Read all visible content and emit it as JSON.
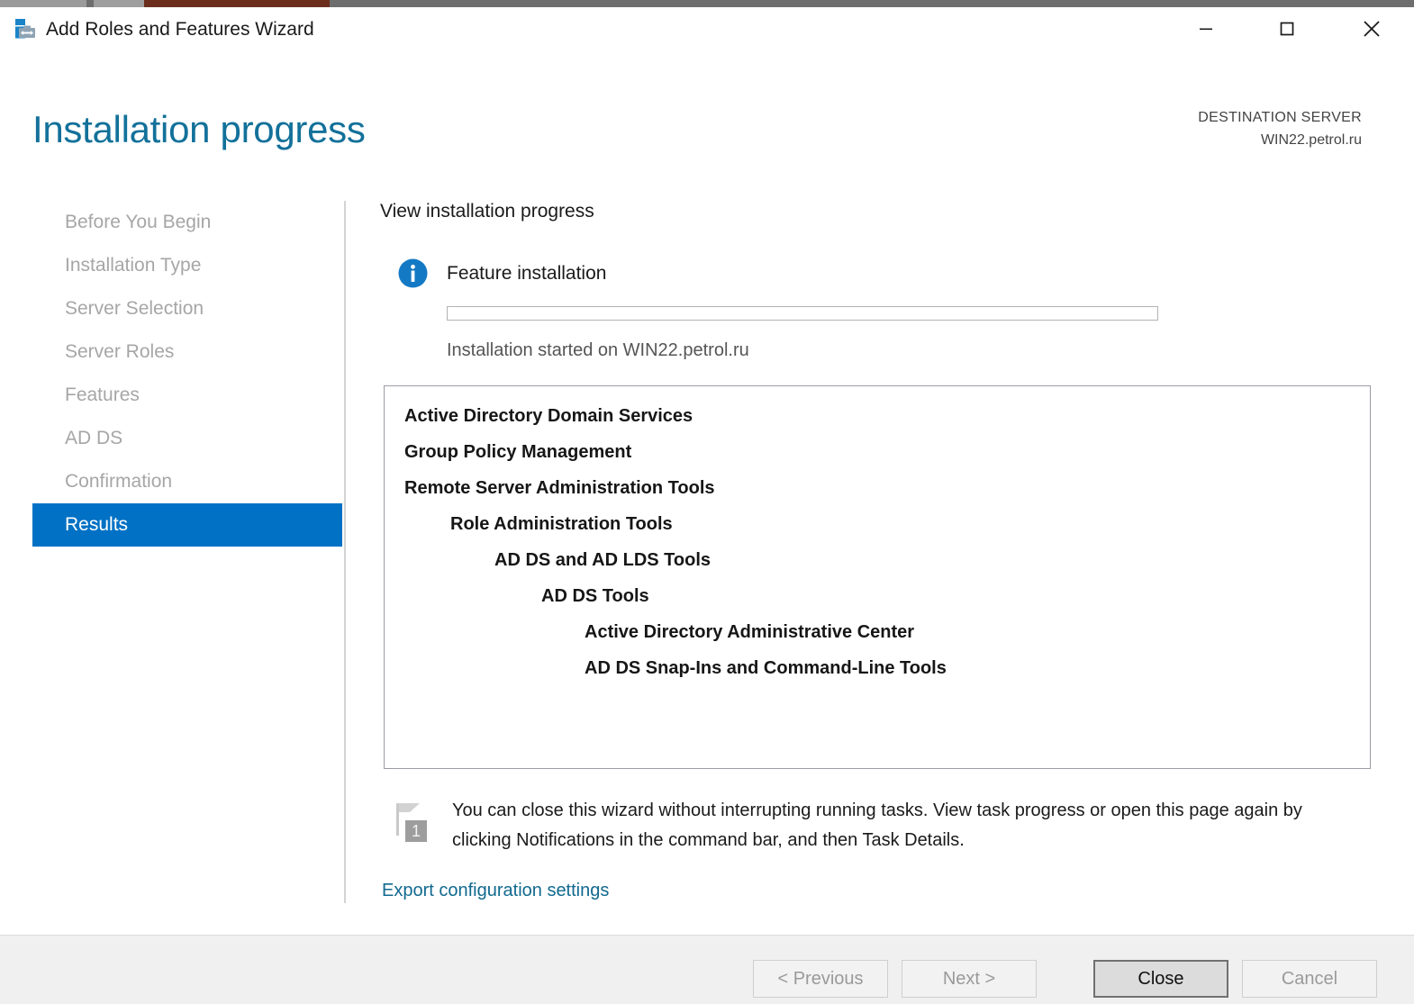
{
  "window": {
    "title": "Add Roles and Features Wizard",
    "app_icon": "server-toolbox-icon",
    "controls": {
      "minimize": "minimize-icon",
      "maximize": "maximize-icon",
      "close": "close-icon"
    }
  },
  "header": {
    "page_title": "Installation progress",
    "destination_label": "DESTINATION SERVER",
    "destination_value": "WIN22.petrol.ru",
    "title_color": "#13719a"
  },
  "sidebar": {
    "items": [
      {
        "label": "Before You Begin",
        "selected": false
      },
      {
        "label": "Installation Type",
        "selected": false
      },
      {
        "label": "Server Selection",
        "selected": false
      },
      {
        "label": "Server Roles",
        "selected": false
      },
      {
        "label": "Features",
        "selected": false
      },
      {
        "label": "AD DS",
        "selected": false
      },
      {
        "label": "Confirmation",
        "selected": false
      },
      {
        "label": "Results",
        "selected": true
      }
    ],
    "selected_color": "#0071c5",
    "disabled_color": "#a6a6a6"
  },
  "main": {
    "heading": "View installation progress",
    "status_icon": "info-icon",
    "status_text": "Feature installation",
    "progress_percent": 0,
    "progress_caption": "Installation started on WIN22.petrol.ru",
    "results": [
      {
        "label": "Active Directory Domain Services",
        "indent": 0
      },
      {
        "label": "Group Policy Management",
        "indent": 0
      },
      {
        "label": "Remote Server Administration Tools",
        "indent": 0
      },
      {
        "label": "Role Administration Tools",
        "indent": 1
      },
      {
        "label": "AD DS and AD LDS Tools",
        "indent": 2
      },
      {
        "label": "AD DS Tools",
        "indent": 3
      },
      {
        "label": "Active Directory Administrative Center",
        "indent": 4
      },
      {
        "label": "AD DS Snap-Ins and Command-Line Tools",
        "indent": 4
      }
    ],
    "notification_icon": "notification-flag-icon",
    "notification_badge": "1",
    "notification_text": "You can close this wizard without interrupting running tasks. View task progress or open this page again by clicking Notifications in the command bar, and then Task Details.",
    "export_link": "Export configuration settings",
    "link_color": "#11698f"
  },
  "footer": {
    "buttons": [
      {
        "label": "< Previous",
        "enabled": false
      },
      {
        "label": "Next >",
        "enabled": false
      },
      {
        "label": "Close",
        "enabled": true
      },
      {
        "label": "Cancel",
        "enabled": false
      }
    ]
  }
}
